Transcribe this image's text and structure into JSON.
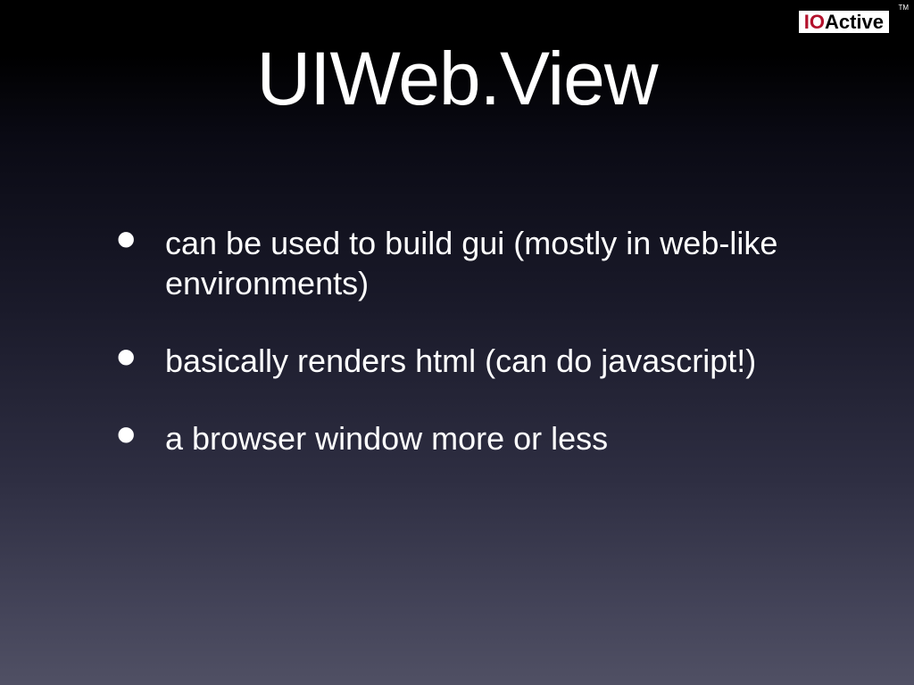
{
  "logo": {
    "part1": "IO",
    "part2": "Active",
    "tm": "TM"
  },
  "title": "UIWeb.View",
  "bullets": [
    "can be used to build gui (mostly in web-like environments)",
    "basically renders html (can do javascript!)",
    "a browser window more or less"
  ]
}
